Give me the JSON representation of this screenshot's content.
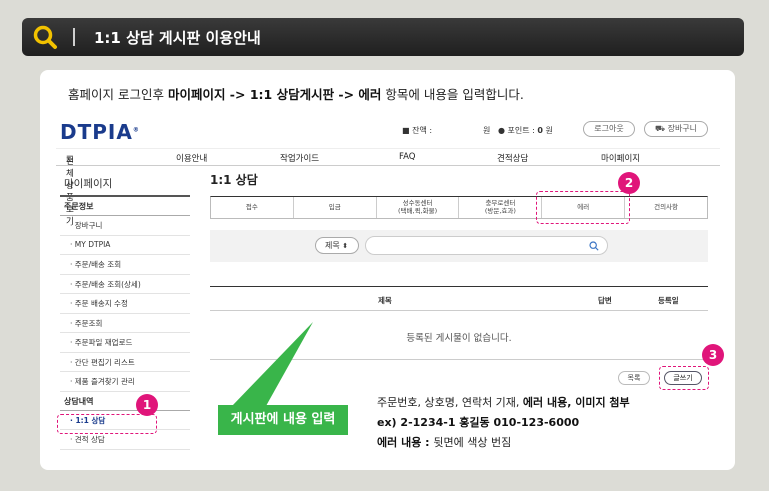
{
  "header": {
    "title": "1:1 상담 게시판 이용안내",
    "icon": "search-icon",
    "accent": "#f2c200"
  },
  "instruction": {
    "pre": "홈페이지 로그인후 ",
    "path": "마이페이지 -> 1:1 상담게시판 -> 에러",
    "post": " 항목에 내용을 입력합니다."
  },
  "site": {
    "logo": "DTPIA",
    "logo_mark": "®",
    "balance_label": "잔액 :",
    "balance_unit": "원",
    "points_label": "포인트 :",
    "points_value": "0",
    "points_unit": "원",
    "logout": "로그아웃",
    "cart": "장바구니"
  },
  "nav": {
    "all_products": "전체상품보기",
    "items": [
      "이용안내",
      "작업가이드",
      "FAQ",
      "견적상담",
      "마이페이지"
    ]
  },
  "sidebar": {
    "title": "마이페이지",
    "section1": "주문정보",
    "items1": [
      "장바구니",
      "MY DTPIA",
      "주문/배송 조회",
      "주문/배송 조회(상세)",
      "주문 배송지 수정",
      "주문조회",
      "주문파일 재업로드",
      "간단 편집기 리스트",
      "제품 즐겨찾기 관리"
    ],
    "section2": "상담내역",
    "items2": [
      "1:1 상담",
      "견적 상담"
    ]
  },
  "main": {
    "title": "1:1 상담",
    "tabs": [
      {
        "line1": "접수",
        "line2": ""
      },
      {
        "line1": "입금",
        "line2": ""
      },
      {
        "line1": "성수동센터",
        "line2": "(택배,퀵,화물)"
      },
      {
        "line1": "충무로센터",
        "line2": "(방문,효과)"
      },
      {
        "line1": "에러",
        "line2": ""
      },
      {
        "line1": "건의사항",
        "line2": ""
      }
    ],
    "search_select": "제목",
    "col_title": "제목",
    "col_answer": "답변",
    "col_date": "등록일",
    "empty": "등록된 게시물이 없습니다.",
    "btn_list": "목록",
    "btn_write": "글쓰기"
  },
  "annotations": {
    "badge1": "1",
    "badge2": "2",
    "badge3": "3",
    "callout": "게시판에 내용 입력",
    "desc1_pre": "주문번호, 상호명, 연락처 기재, ",
    "desc1_bold": "에러 내용, 이미지 첨부",
    "desc2": "ex) 2-1234-1  홍길동 010-123-6000",
    "desc3_label": "에러 내용 : ",
    "desc3_value": "뒷면에 색상 번짐",
    "highlight_color": "#e0157a",
    "callout_color": "#39b54a"
  }
}
